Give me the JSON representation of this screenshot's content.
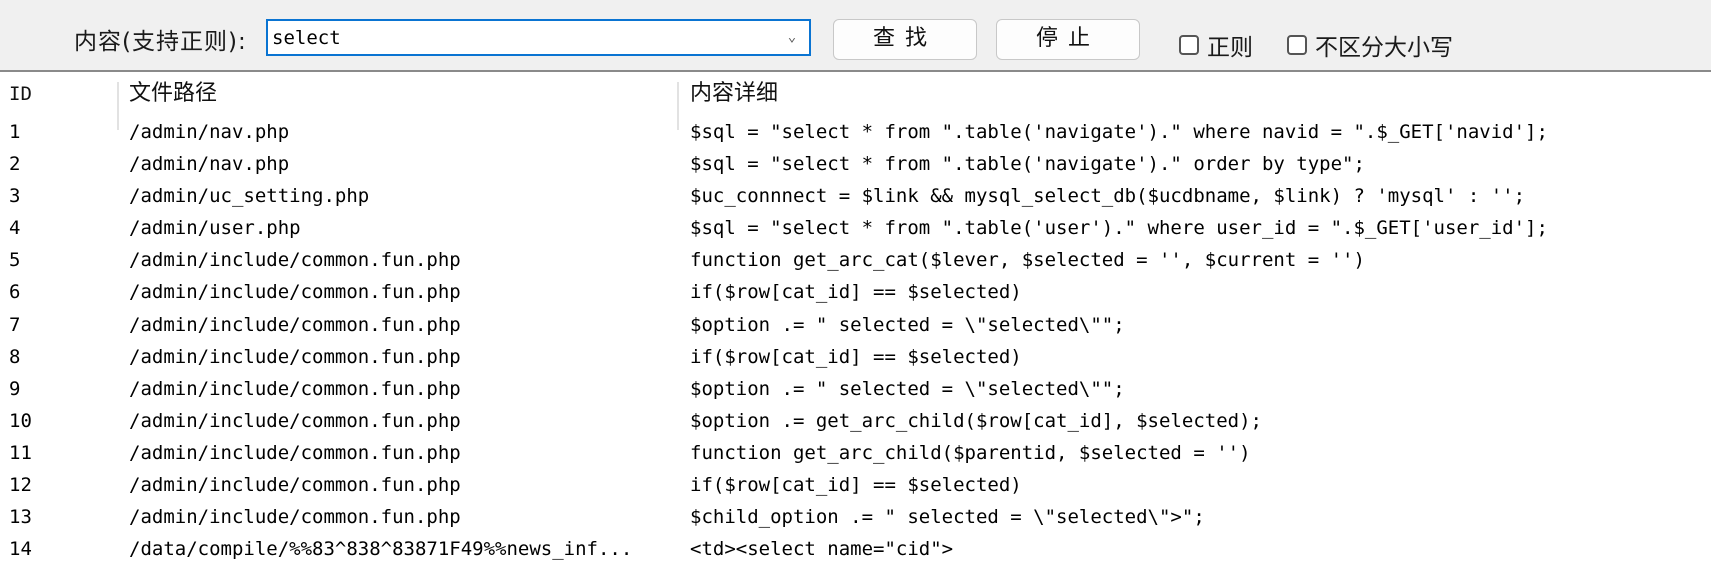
{
  "toolbar": {
    "search_label": "内容(支持正则):",
    "search_value": "select",
    "dropdown_icon": "chevron-down-icon",
    "find_button": "查找",
    "stop_button": "停止",
    "regex_checkbox": {
      "label": "正则",
      "checked": false
    },
    "case_checkbox": {
      "label": "不区分大小写",
      "checked": false
    }
  },
  "table": {
    "columns": [
      "ID",
      "文件路径",
      "内容详细"
    ],
    "rows": [
      {
        "id": "1",
        "path": "/admin/nav.php",
        "detail": "$sql = \"select * from \".table('navigate').\" where navid = \".$_GET['navid'];"
      },
      {
        "id": "2",
        "path": "/admin/nav.php",
        "detail": "$sql = \"select * from \".table('navigate').\" order by type\";"
      },
      {
        "id": "3",
        "path": "/admin/uc_setting.php",
        "detail": "$uc_connnect = $link && mysql_select_db($ucdbname, $link) ? 'mysql' : '';"
      },
      {
        "id": "4",
        "path": "/admin/user.php",
        "detail": "$sql = \"select * from \".table('user').\" where user_id = \".$_GET['user_id'];"
      },
      {
        "id": "5",
        "path": "/admin/include/common.fun.php",
        "detail": "function get_arc_cat($lever, $selected = '', $current = '')"
      },
      {
        "id": "6",
        "path": "/admin/include/common.fun.php",
        "detail": "if($row[cat_id] == $selected)"
      },
      {
        "id": "7",
        "path": "/admin/include/common.fun.php",
        "detail": "$option .= \" selected = \\\"selected\\\"\";"
      },
      {
        "id": "8",
        "path": "/admin/include/common.fun.php",
        "detail": "if($row[cat_id] == $selected)"
      },
      {
        "id": "9",
        "path": "/admin/include/common.fun.php",
        "detail": "$option .= \" selected = \\\"selected\\\"\";"
      },
      {
        "id": "10",
        "path": "/admin/include/common.fun.php",
        "detail": "$option .= get_arc_child($row[cat_id], $selected);"
      },
      {
        "id": "11",
        "path": "/admin/include/common.fun.php",
        "detail": "function get_arc_child($parentid, $selected = '')"
      },
      {
        "id": "12",
        "path": "/admin/include/common.fun.php",
        "detail": "if($row[cat_id] == $selected)"
      },
      {
        "id": "13",
        "path": "/admin/include/common.fun.php",
        "detail": "$child_option .= \" selected = \\\"selected\\\">\";"
      },
      {
        "id": "14",
        "path": "/data/compile/%%83^838^83871F49%%news_inf...",
        "detail": "<td><select name=\"cid\">"
      }
    ]
  }
}
